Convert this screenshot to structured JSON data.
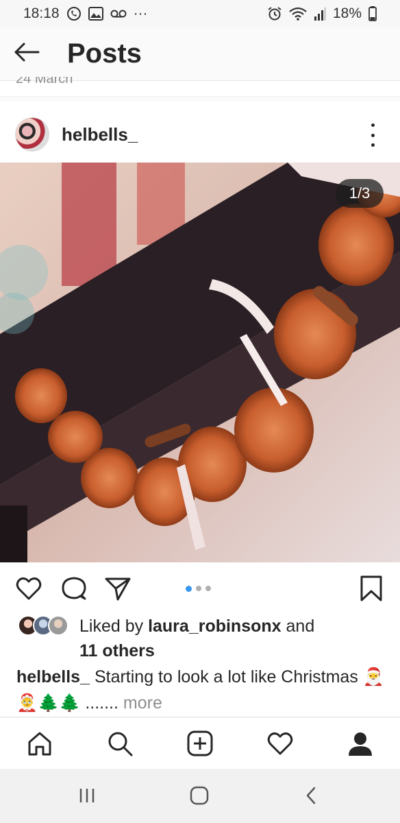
{
  "status_bar": {
    "time": "18:18",
    "battery": "18%",
    "more_indicator": "···",
    "icons": [
      "whatsapp-icon",
      "gallery-icon",
      "voicemail-icon",
      "alarm-icon",
      "wifi-icon",
      "signal-icon",
      "battery-icon"
    ]
  },
  "header": {
    "title": "Posts",
    "back_icon": "arrow-left-icon"
  },
  "date_label": "24 March",
  "post": {
    "username": "helbells_",
    "image_counter": "1/3",
    "carousel": {
      "total": 3,
      "active_index": 0
    },
    "likes": {
      "prefix": "Liked by ",
      "user": "laura_robinsonx",
      "connector": " and",
      "others": "11 others"
    },
    "caption": {
      "user": "helbells_",
      "text": " Starting to look a lot like Christmas 🎅🤶🌲🌲 .......",
      "more": " more"
    }
  },
  "bottom_nav": [
    "home-icon",
    "search-icon",
    "add-icon",
    "activity-heart-icon",
    "profile-icon"
  ],
  "system_nav": [
    "recents-icon",
    "home-button-icon",
    "back-icon"
  ],
  "colors": {
    "accent_blue": "#3897f0",
    "text": "#262626",
    "muted": "#8e8e8e"
  }
}
